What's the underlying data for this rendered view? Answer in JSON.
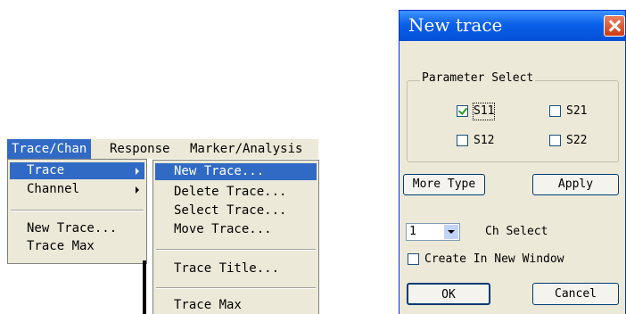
{
  "menubar": {
    "items": [
      {
        "label": "Trace/Chan"
      },
      {
        "label": "Response"
      },
      {
        "label": "Marker/Analysis"
      }
    ]
  },
  "trace_chan_menu": {
    "items": [
      {
        "label": "Trace",
        "has_submenu": true,
        "selected": true
      },
      {
        "label": "Channel",
        "has_submenu": true
      },
      {
        "label": "New Trace..."
      },
      {
        "label": "Trace Max"
      }
    ]
  },
  "trace_submenu": {
    "items": [
      {
        "label": "New Trace...",
        "selected": true
      },
      {
        "label": "Delete Trace..."
      },
      {
        "label": "Select Trace..."
      },
      {
        "label": "Move Trace..."
      },
      {
        "label": "Trace Title..."
      },
      {
        "label": "Trace Max"
      }
    ]
  },
  "dialog": {
    "title": "New trace",
    "parameter_group": {
      "legend": "Parameter Select",
      "options": [
        {
          "label": "S11",
          "checked": true
        },
        {
          "label": "S21",
          "checked": false
        },
        {
          "label": "S12",
          "checked": false
        },
        {
          "label": "S22",
          "checked": false
        }
      ]
    },
    "more_type_label": "More Type",
    "apply_label": "Apply",
    "channel_value": "1",
    "channel_label": "Ch Select",
    "new_window_label": "Create In New Window",
    "new_window_checked": false,
    "ok_label": "OK",
    "cancel_label": "Cancel"
  },
  "colors": {
    "menu_background": "#ece9d8",
    "menu_selection": "#316ac5",
    "titlebar_blue": "#0a5fe8",
    "close_button_red": "#cf3b12"
  }
}
